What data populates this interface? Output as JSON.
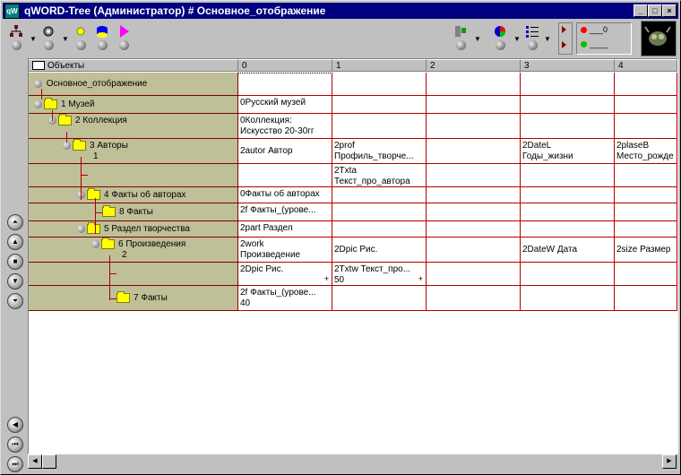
{
  "window": {
    "title": "qWORD-Tree (Администратор) # Основное_отображение",
    "app_icon": "qW"
  },
  "toolbar": {
    "indicators": [
      {
        "label": "___0"
      },
      {
        "label": "____"
      }
    ]
  },
  "grid": {
    "header_objects": "Объекты",
    "column_headers": [
      "0",
      "1",
      "2",
      "3",
      "4"
    ],
    "rows": [
      {
        "node": "Основное_отображение",
        "cells": [
          "",
          "",
          "",
          "",
          ""
        ]
      },
      {
        "node": "1 Музей",
        "cells": [
          "0Русский музей",
          "",
          "",
          "",
          ""
        ]
      },
      {
        "node": "2 Коллекция",
        "cells": [
          "0Коллекция: Искусство 20-30гг",
          "",
          "",
          "",
          ""
        ]
      },
      {
        "node": "3 Авторы",
        "node2": "1",
        "cells": [
          "2autor Автор",
          "2prof Профиль_творче...",
          "",
          "2DateL Годы_жизни",
          "2plaseB Место_рожде"
        ]
      },
      {
        "node": "",
        "cells": [
          "",
          "2Txta Текст_про_автора",
          "",
          "",
          ""
        ]
      },
      {
        "node": "4 Факты об авторах",
        "cells": [
          "0Факты об авторах",
          "",
          "",
          "",
          ""
        ]
      },
      {
        "node": "8 Факты",
        "cells": [
          "2f Факты_(урове...",
          "",
          "",
          "",
          ""
        ]
      },
      {
        "node": "5 Раздел творчества",
        "cells": [
          "2part Раздел",
          "",
          "",
          "",
          ""
        ]
      },
      {
        "node": "6 Произведения",
        "node2": "2",
        "cells": [
          "2work Произведение",
          "2Dpic Рис.",
          "",
          "2DateW Дата",
          "2size Размер"
        ]
      },
      {
        "node": "",
        "cells": [
          "2Dpic Рис.",
          "2Txtw Текст_про... 50",
          "",
          "",
          ""
        ]
      },
      {
        "node": "7 Факты",
        "cells": [
          "2f Факты_(урове... 40",
          "",
          "",
          "",
          ""
        ]
      }
    ]
  },
  "cell_split": {
    "r2c0": [
      "0Коллекция:",
      "Искусство 20-30гг"
    ],
    "r3c0": [
      "2autor Автор"
    ],
    "r3c1": [
      "2prof",
      "Профиль_творче..."
    ],
    "r3c3": [
      "2DateL",
      "Годы_жизни"
    ],
    "r3c4": [
      "2plaseB",
      "Место_рожде"
    ],
    "r4c1": [
      "2Txta",
      "Текст_про_автора"
    ],
    "r8c0": [
      "2work",
      "Произведение"
    ],
    "r9c0": [
      "2Dpic Рис."
    ],
    "r9c1": [
      "2Txtw Текст_про...",
      "50"
    ],
    "r10c0": [
      "2f Факты_(урове...",
      "40"
    ]
  },
  "plus_mark": "+"
}
